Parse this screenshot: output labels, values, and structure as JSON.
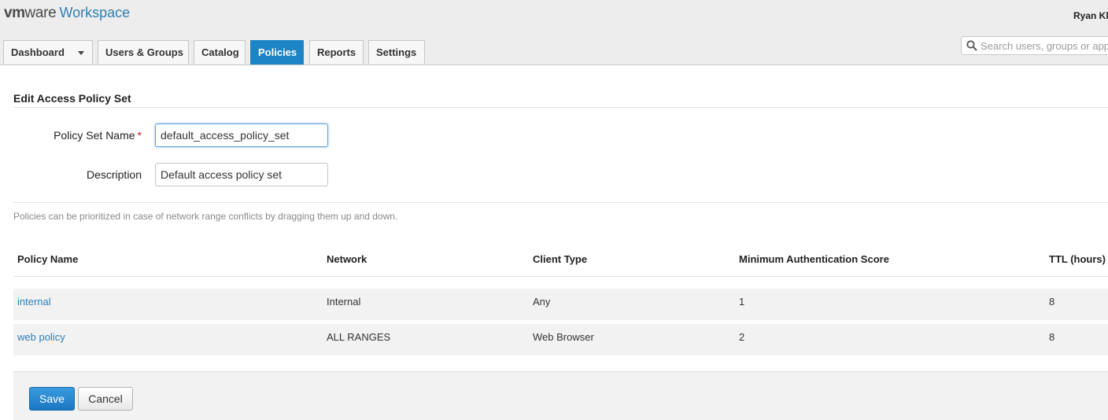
{
  "header": {
    "logo_vm": "vm",
    "logo_ware": "ware",
    "product": "Workspace",
    "user_name": "Ryan Kl"
  },
  "tabs": [
    {
      "label": "Dashboard",
      "active": false,
      "has_dropdown": true
    },
    {
      "label": "Users & Groups",
      "active": false
    },
    {
      "label": "Catalog",
      "active": false
    },
    {
      "label": "Policies",
      "active": true
    },
    {
      "label": "Reports",
      "active": false
    },
    {
      "label": "Settings",
      "active": false
    }
  ],
  "search": {
    "placeholder": "Search users, groups or apps"
  },
  "page": {
    "title": "Edit Access Policy Set",
    "policy_set_name_label": "Policy Set Name",
    "required_mark": "*",
    "policy_set_name_value": "default_access_policy_set",
    "description_label": "Description",
    "description_value": "Default access policy set",
    "hint": "Policies can be prioritized in case of network range conflicts by dragging them up and down."
  },
  "table": {
    "columns": [
      "Policy Name",
      "Network",
      "Client Type",
      "Minimum Authentication Score",
      "TTL (hours)"
    ],
    "rows": [
      {
        "name": "internal",
        "network": "Internal",
        "client_type": "Any",
        "min_score": "1",
        "ttl": "8"
      },
      {
        "name": "web policy",
        "network": "ALL RANGES",
        "client_type": "Web Browser",
        "min_score": "2",
        "ttl": "8"
      }
    ]
  },
  "actions": {
    "save": "Save",
    "cancel": "Cancel"
  },
  "colors": {
    "accent": "#1d84c5",
    "link": "#2e7fb6",
    "required": "#c41a1a"
  }
}
